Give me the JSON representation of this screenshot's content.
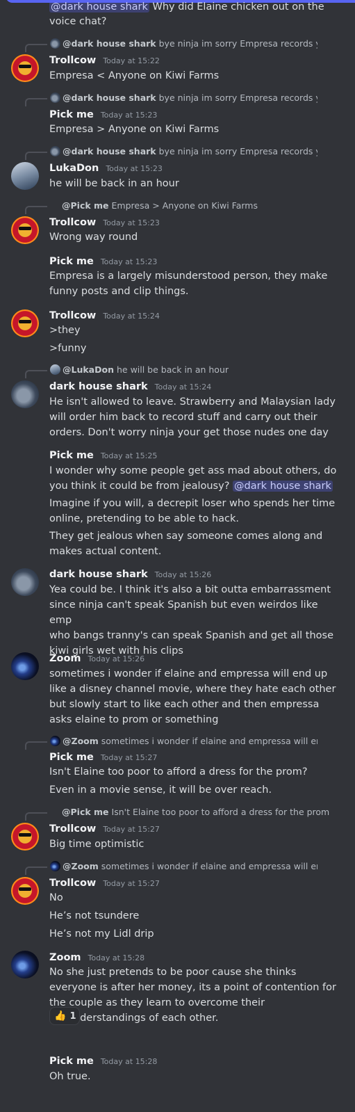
{
  "header_fragment": {
    "mention": "@dark house shark",
    "text_after": " Why did Elaine chicken out on the",
    "line2": "voice chat?"
  },
  "messages": [
    {
      "reply": {
        "user": "@dark house shark",
        "text": "bye ninja im sorry Empresa records you. We"
      },
      "author": "Trollcow",
      "time": "Today at 15:22",
      "lines": [
        "Empresa < Anyone on Kiwi Farms"
      ]
    },
    {
      "reply": {
        "user": "@dark house shark",
        "text": "bye ninja im sorry Empresa records you. We"
      },
      "author": "Pick me",
      "time": "Today at 15:23",
      "lines": [
        "Empresa > Anyone on Kiwi Farms"
      ]
    },
    {
      "reply": {
        "user": "@dark house shark",
        "text": "bye ninja im sorry Empresa records you. We"
      },
      "author": "LukaDon",
      "time": "Today at 15:23",
      "lines": [
        "he will be back in an hour"
      ]
    },
    {
      "reply": {
        "user": "@Pick me",
        "text": "Empresa > Anyone on Kiwi Farms"
      },
      "author": "Trollcow",
      "time": "Today at 15:23",
      "lines": [
        "Wrong way round"
      ]
    },
    {
      "author": "Pick me",
      "time": "Today at 15:23",
      "lines": [
        "Empresa is a largely misunderstood person, they make\nfunny posts and clip things."
      ]
    },
    {
      "author": "Trollcow",
      "time": "Today at 15:24",
      "lines": [
        ">they",
        ">funny"
      ]
    },
    {
      "reply": {
        "user": "@LukaDon",
        "text": "he will be back in an hour"
      },
      "author": "dark house shark",
      "time": "Today at 15:24",
      "lines": [
        "He isn't allowed to leave. Strawberry and Malaysian lady\nwill order him back to record stuff and carry out their\norders. Don't worry ninja your get those nudes one day"
      ]
    },
    {
      "author": "Pick me",
      "time": "Today at 15:25",
      "lines": [
        {
          "text": "I wonder why some people get ass mad about others, do\nyou think it could be from jealousy? ",
          "mention": "@dark house shark"
        },
        "Imagine if you will, a decrepit loser who spends her time\nonline, pretending to be able to hack.",
        "They get jealous when say someone comes along and\nmakes actual content."
      ]
    },
    {
      "author": "dark house shark",
      "time": "Today at 15:26",
      "lines": [
        "Yea could be. I think it's also a bit outta embarrassment\nsince ninja can't speak Spanish but even weirdos like emp\nwho bangs tranny's can speak Spanish and get all those\nkiwi girls wet with his clips"
      ]
    },
    {
      "author": "Zoom",
      "time": "Today at 15:26",
      "lines": [
        "sometimes i wonder if elaine and empressa will end up\nlike a disney channel movie, where they hate each other\nbut slowly start to like each other and then empressa\nasks elaine to prom or something"
      ]
    },
    {
      "reply": {
        "user": "@Zoom",
        "text": "sometimes i wonder if elaine and empressa will end up"
      },
      "author": "Pick me",
      "time": "Today at 15:27",
      "lines": [
        "Isn't Elaine too poor to afford a dress for the prom?",
        "Even in a movie sense, it will be over reach."
      ]
    },
    {
      "reply": {
        "user": "@Pick me",
        "text": "Isn't Elaine too poor to afford a dress for the prom?"
      },
      "author": "Trollcow",
      "time": "Today at 15:27",
      "lines": [
        "Big time optimistic"
      ]
    },
    {
      "reply": {
        "user": "@Zoom",
        "text": "sometimes i wonder if elaine and empressa will end up"
      },
      "author": "Trollcow",
      "time": "Today at 15:27",
      "lines": [
        "No",
        "He’s not tsundere",
        "He’s not my Lidl drip"
      ]
    },
    {
      "author": "Zoom",
      "time": "Today at 15:28",
      "lines": [
        "No she just pretends to be poor cause she thinks\neveryone is after her money, its a point of contention for\nthe couple as they learn to overcome their\nmisunderstandings of each other."
      ],
      "reaction": {
        "emoji": "👍",
        "count": "1"
      }
    },
    {
      "author": "Pick me",
      "time": "Today at 15:28",
      "lines": [
        "Oh true."
      ]
    }
  ]
}
